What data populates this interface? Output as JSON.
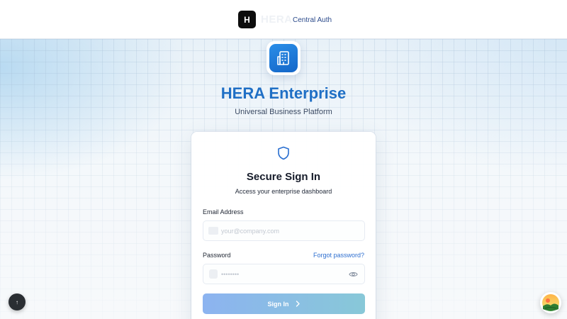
{
  "header": {
    "brand_initial": "H",
    "brand_ghost_text": "HERA",
    "central_auth_label": "Central Auth"
  },
  "hero": {
    "title": "HERA Enterprise",
    "subtitle": "Universal Business Platform",
    "icon": "building-icon"
  },
  "signin_card": {
    "icon": "shield-icon",
    "title": "Secure Sign In",
    "subtitle": "Access your enterprise dashboard",
    "email": {
      "label": "Email Address",
      "placeholder": "your@company.com",
      "value": "",
      "icon": "mail-icon"
    },
    "password": {
      "label": "Password",
      "placeholder": "••••••••",
      "value": "",
      "icon": "lock-icon",
      "toggle_icon": "eye-icon"
    },
    "forgot_password_label": "Forgot password?",
    "submit_label": "Sign In",
    "submit_icon": "chevron-right-icon"
  },
  "floating": {
    "help_icon": "info-icon",
    "assistant_icon": "assistant-avatar-icon"
  },
  "colors": {
    "accent": "#1f6fc5",
    "link": "#2e6fd0",
    "button_gradient_start": "#8cb3f0",
    "button_gradient_end": "#88c8d8",
    "brand_mark": "#0d0d0d"
  }
}
